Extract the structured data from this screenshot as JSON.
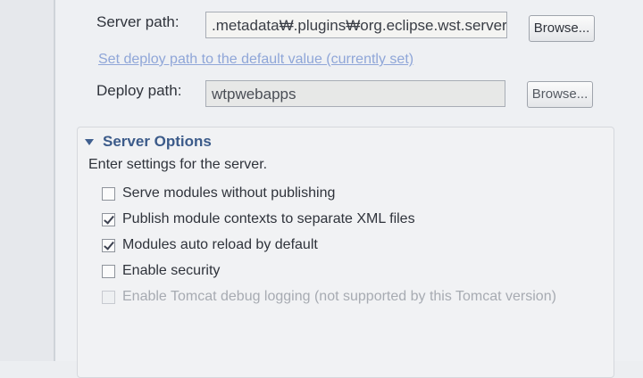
{
  "server": {
    "server_path_label": "Server path:",
    "server_path_value": ".metadata₩.plugins₩org.eclipse.wst.server.c",
    "browse_label": "Browse...",
    "set_deploy_link": "Set deploy path to the default value (currently set)",
    "deploy_path_label": "Deploy path:",
    "deploy_path_value": "wtpwebapps",
    "deploy_browse_label": "Browse..."
  },
  "server_options": {
    "title": "Server Options",
    "description": "Enter settings for the server.",
    "options": [
      {
        "label": "Serve modules without publishing",
        "checked": false,
        "enabled": true
      },
      {
        "label": "Publish module contexts to separate XML files",
        "checked": true,
        "enabled": true
      },
      {
        "label": "Modules auto reload by default",
        "checked": true,
        "enabled": true
      },
      {
        "label": "Enable security",
        "checked": false,
        "enabled": true
      },
      {
        "label": "Enable Tomcat debug logging (not supported by this Tomcat version)",
        "checked": false,
        "enabled": false
      }
    ]
  }
}
